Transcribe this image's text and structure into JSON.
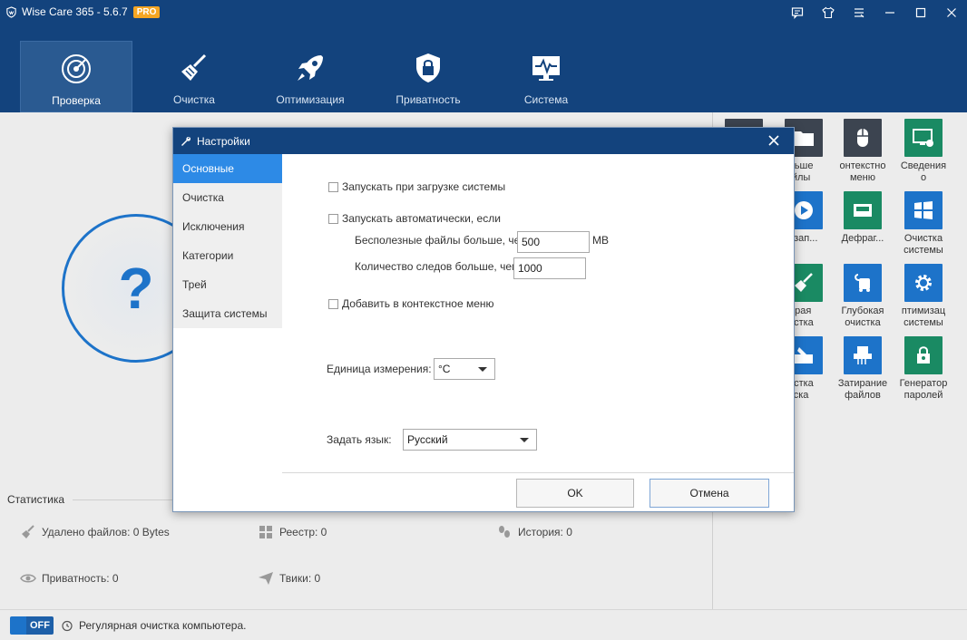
{
  "app": {
    "title": "Wise Care 365 - 5.6.7",
    "badge": "PRO"
  },
  "colors": {
    "header": "#13437d",
    "accent": "#2d8ae6",
    "tile_dark": "#3c4450",
    "tile_green": "#1a8a63",
    "tile_blue": "#1d73c9"
  },
  "nav": [
    {
      "label": "Проверка",
      "icon": "radar-icon"
    },
    {
      "label": "Очистка",
      "icon": "broom-icon"
    },
    {
      "label": "Оптимизация",
      "icon": "rocket-icon"
    },
    {
      "label": "Приватность",
      "icon": "lock-shield-icon"
    },
    {
      "label": "Система",
      "icon": "monitor-pulse-icon"
    }
  ],
  "tiles": [
    {
      "label": "",
      "icon": "tile-icon"
    },
    {
      "label": "ольше\nайлы",
      "icon": "folder-icon"
    },
    {
      "label": "онтекстно\nменю",
      "icon": "mouse-icon"
    },
    {
      "label": "Сведения\nо",
      "icon": "monitor-gear-icon"
    },
    {
      "label": "втозап...",
      "icon": "play-icon"
    },
    {
      "label": "Дефраг...",
      "icon": "disk-icon"
    },
    {
      "label": "Очистка\nсистемы",
      "icon": "windows-icon"
    },
    {
      "label": "страя\nчистка",
      "icon": "broom-icon"
    },
    {
      "label": "Глубокая\nочистка",
      "icon": "vacuum-icon"
    },
    {
      "label": "птимизац\nсистемы",
      "icon": "gear-icon"
    },
    {
      "label": "чистка\nиска",
      "icon": "disk-clean-icon"
    },
    {
      "label": "Затирание\nфайлов",
      "icon": "shredder-icon"
    },
    {
      "label": "Генератор\nпаролей",
      "icon": "password-icon"
    }
  ],
  "stats": {
    "title": "Статистика",
    "deleted": "Удалено файлов: 0 Bytes",
    "registry": "Реестр: 0",
    "history": "История: 0",
    "privacy": "Приватность: 0",
    "tweaks": "Твики: 0"
  },
  "bottom": {
    "toggle": "OFF",
    "text": "Регулярная очистка компьютера."
  },
  "dialog": {
    "title": "Настройки",
    "sidebar": [
      "Основные",
      "Очистка",
      "Исключения",
      "Категории",
      "Трей",
      "Защита системы"
    ],
    "startup": "Запускать при загрузке системы",
    "auto_run": "Запускать автоматически, если",
    "junk_label": "Бесполезные файлы больше, чем",
    "junk_value": "500",
    "junk_unit": "MB",
    "traces_label": "Количество следов больше, чем",
    "traces_value": "1000",
    "context_menu": "Добавить в контекстное меню",
    "unit_label": "Единица измерения:",
    "unit_value": "°C",
    "lang_label": "Задать язык:",
    "lang_value": "Русский",
    "ok": "OK",
    "cancel": "Отмена"
  }
}
